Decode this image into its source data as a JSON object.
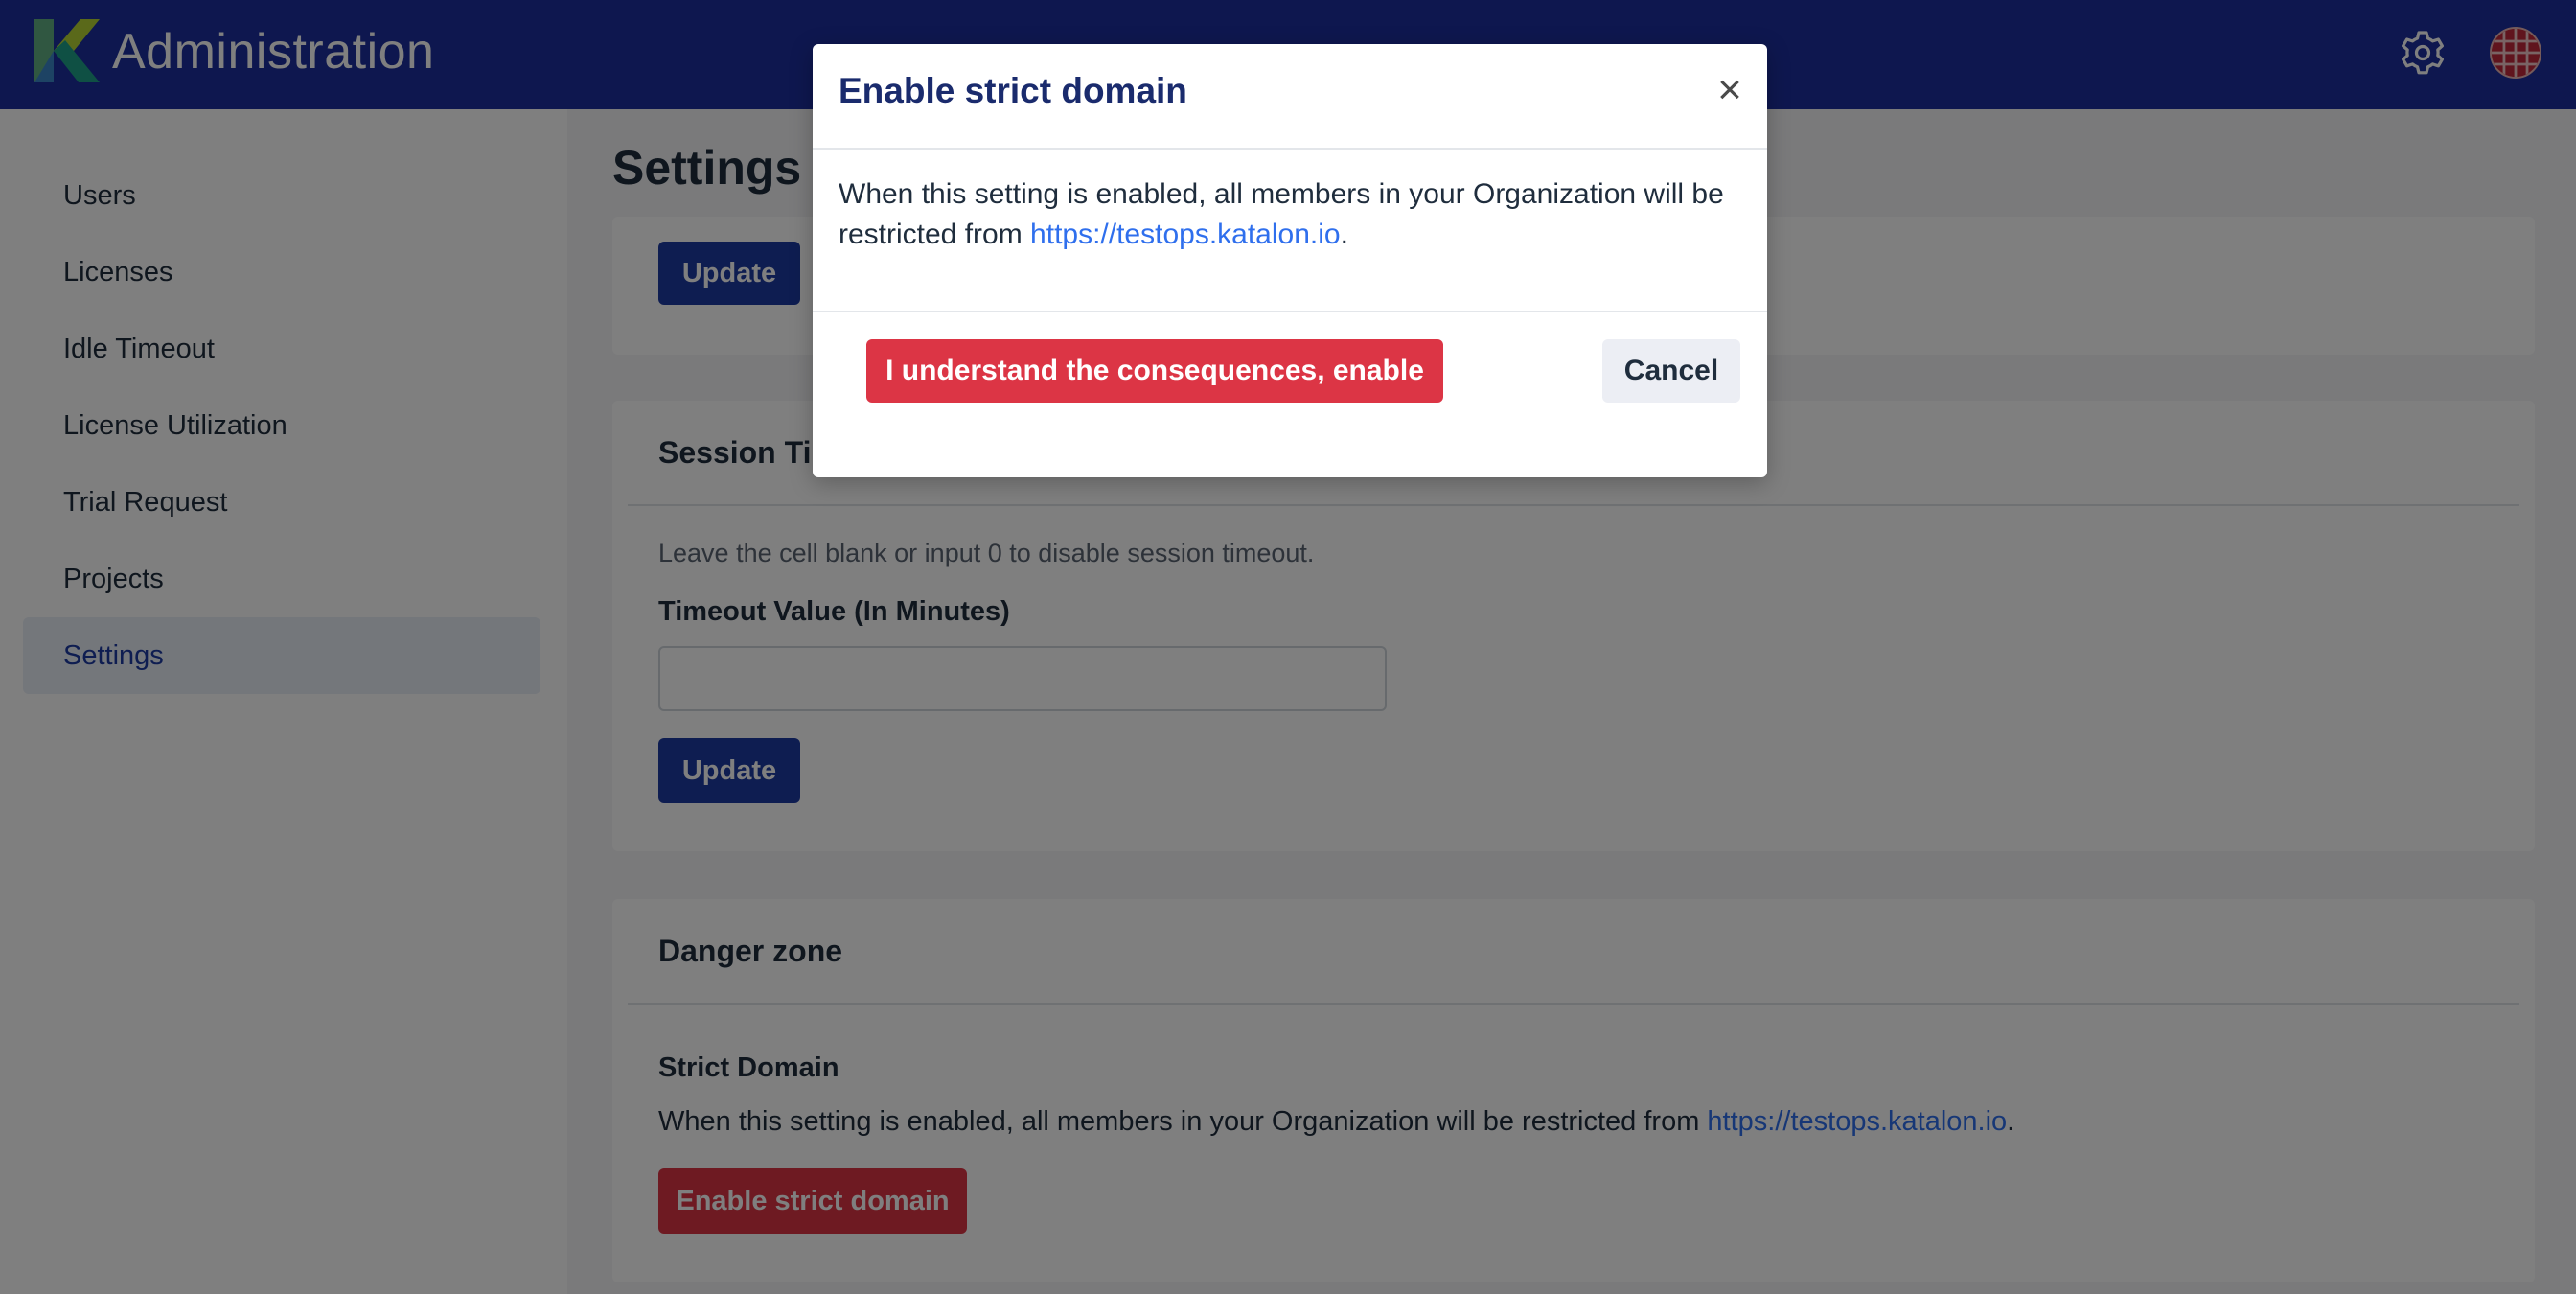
{
  "header": {
    "app_title": "Administration",
    "logo_icon": "katalon-logo",
    "settings_icon": "gear-icon",
    "avatar_icon": "user-avatar"
  },
  "sidebar": {
    "items": [
      {
        "label": "Users",
        "active": false
      },
      {
        "label": "Licenses",
        "active": false
      },
      {
        "label": "Idle Timeout",
        "active": false
      },
      {
        "label": "License Utilization",
        "active": false
      },
      {
        "label": "Trial Request",
        "active": false
      },
      {
        "label": "Projects",
        "active": false
      },
      {
        "label": "Settings",
        "active": true
      }
    ]
  },
  "main": {
    "page_title": "Settings",
    "top_card": {
      "update_label": "Update"
    },
    "session_card": {
      "title": "Session Timeout",
      "helper": "Leave the cell blank or input 0 to disable session timeout.",
      "field_label": "Timeout Value (In Minutes)",
      "field_value": "",
      "update_label": "Update"
    },
    "danger_card": {
      "title": "Danger zone",
      "strict_title": "Strict Domain",
      "strict_text": "When this setting is enabled, all members in your Organization will be restricted from ",
      "strict_link": "https://testops.katalon.io",
      "strict_end": ".",
      "enable_label": "Enable strict domain"
    }
  },
  "modal": {
    "title": "Enable strict domain",
    "close_icon": "close-icon",
    "body_text": "When this setting is enabled, all members in your Organization will be restricted from ",
    "body_link": "https://testops.katalon.io",
    "body_end": ".",
    "confirm_label": "I understand the consequences, enable strict domain",
    "cancel_label": "Cancel"
  },
  "colors": {
    "header": "#1d2f9e",
    "primary": "#1d3aa3",
    "danger": "#dc3545",
    "link": "#2f6fed"
  }
}
